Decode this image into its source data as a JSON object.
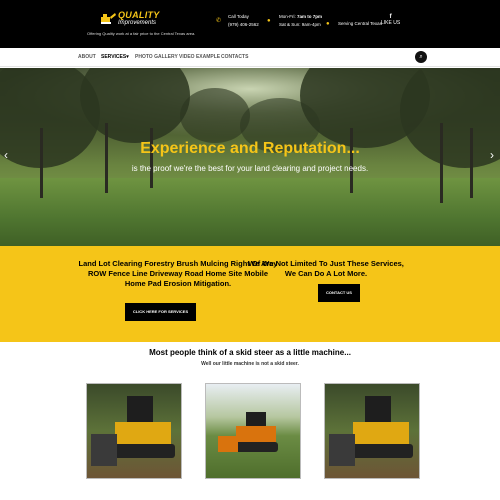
{
  "header": {
    "logo_title": "QUALITY",
    "logo_subtitle": "Improvements",
    "tagline": "Offering Quality work at a fair price to the Central Texas area.",
    "call_label": "Call Today",
    "phone": "(979) 406-2562",
    "hours_weekday_prefix": "Mon-Fri: ",
    "hours_weekday": "7am to 7pm",
    "hours_weekend": "Sat & Sun: 9am-4pm",
    "service_area": "Serving Central Texas",
    "social_icon": "f",
    "social_label": "LIKE US"
  },
  "nav": {
    "items": [
      "ABOUT",
      "SERVICES▾",
      "PHOTO GALLERY",
      "VIDEO EXAMPLE",
      "CONTACTS"
    ],
    "active": "SERVICES▾"
  },
  "hero": {
    "title": "Experience and Reputation...",
    "subtitle": "is the proof we're the best for your land clearing and project needs.",
    "prev_icon": "chevron-left-icon",
    "next_icon": "chevron-right-icon"
  },
  "services": {
    "text": "Land Lot Clearing Forestry Brush Mulcing Right Of Way ROW Fence Line Driveway Road Home Site Mobile Home Pad Erosion Mitigation.",
    "button": "CLICK HERE FOR SERVICES"
  },
  "more": {
    "text": "We Are Not Limited To Just These Services, We Can Do A Lot More.",
    "button": "CONTACT US"
  },
  "machine": {
    "headline": "Most people think of a skid steer as a little machine...",
    "subline": "Well our little machine is not a skid steer."
  },
  "colors": {
    "accent": "#f5c518",
    "dark": "#000000"
  }
}
